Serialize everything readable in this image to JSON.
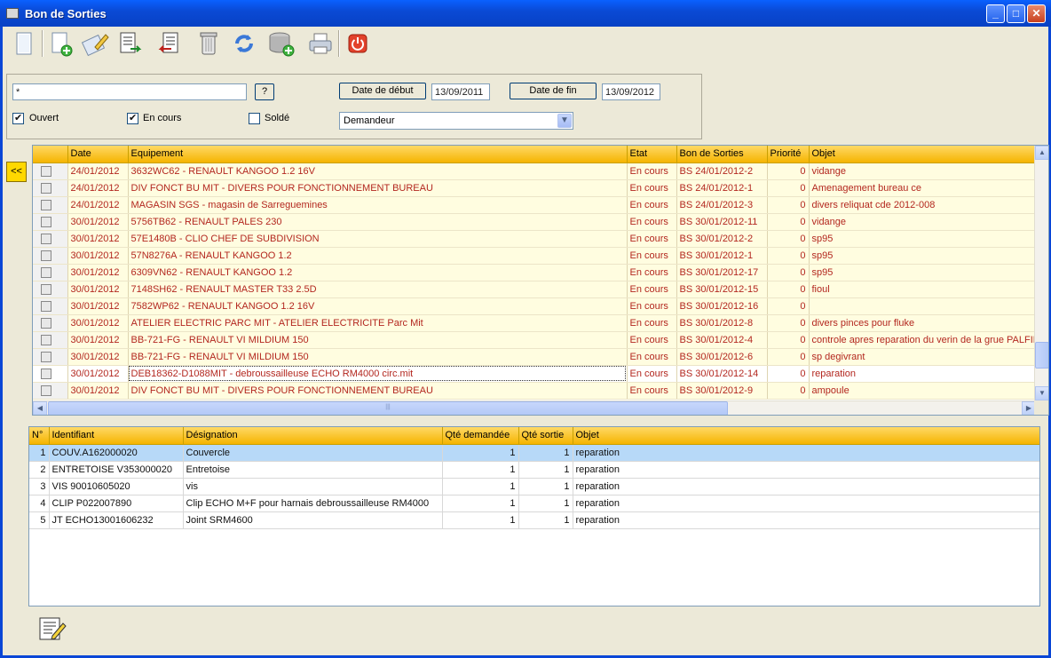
{
  "window": {
    "title": "Bon de Sorties"
  },
  "toolbar": {
    "icons": [
      "new-document-icon",
      "add-document-icon",
      "edit-icon",
      "export-icon",
      "import-icon",
      "delete-icon",
      "refresh-icon",
      "database-add-icon",
      "print-icon",
      "power-icon"
    ]
  },
  "filters": {
    "search_value": "*",
    "help_label": "?",
    "date_debut_label": "Date de début",
    "date_debut_value": "13/09/2011",
    "date_fin_label": "Date de fin",
    "date_fin_value": "13/09/2012",
    "ouvert_label": "Ouvert",
    "ouvert_checked": true,
    "encours_label": "En cours",
    "encours_checked": true,
    "solde_label": "Soldé",
    "solde_checked": false,
    "group_select": "Demandeur"
  },
  "collapse_label": "<<",
  "sorties": {
    "columns": [
      "Date",
      "Equipement",
      "Etat",
      "Bon de Sorties",
      "Priorité",
      "Objet"
    ],
    "rows": [
      [
        "24/01/2012",
        "3632WC62 - RENAULT KANGOO 1.2 16V",
        "En cours",
        "BS 24/01/2012-2",
        "0",
        "vidange"
      ],
      [
        "24/01/2012",
        "DIV FONCT BU MIT - DIVERS POUR FONCTIONNEMENT BUREAU",
        "En cours",
        "BS 24/01/2012-1",
        "0",
        "Amenagement bureau ce"
      ],
      [
        "24/01/2012",
        "MAGASIN SGS - magasin de Sarreguemines",
        "En cours",
        "BS 24/01/2012-3",
        "0",
        "divers reliquat cde  2012-008"
      ],
      [
        "30/01/2012",
        "5756TB62 - RENAULT PALES 230",
        "En cours",
        "BS 30/01/2012-11",
        "0",
        "vidange"
      ],
      [
        "30/01/2012",
        "57E1480B - CLIO CHEF DE SUBDIVISION",
        "En cours",
        "BS 30/01/2012-2",
        "0",
        "sp95"
      ],
      [
        "30/01/2012",
        "57N8276A - RENAULT KANGOO 1.2",
        "En cours",
        "BS 30/01/2012-1",
        "0",
        "sp95"
      ],
      [
        "30/01/2012",
        "6309VN62 - RENAULT KANGOO 1.2",
        "En cours",
        "BS 30/01/2012-17",
        "0",
        "sp95"
      ],
      [
        "30/01/2012",
        "7148SH62 - RENAULT MASTER T33 2.5D",
        "En cours",
        "BS 30/01/2012-15",
        "0",
        "fioul"
      ],
      [
        "30/01/2012",
        "7582WP62 - RENAULT KANGOO 1.2 16V",
        "En cours",
        "BS 30/01/2012-16",
        "0",
        ""
      ],
      [
        "30/01/2012",
        "ATELIER ELECTRIC PARC MIT - ATELIER ELECTRICITE Parc Mit",
        "En cours",
        "BS 30/01/2012-8",
        "0",
        "divers pinces pour fluke"
      ],
      [
        "30/01/2012",
        "BB-721-FG - RENAULT VI MILDIUM 150",
        "En cours",
        "BS 30/01/2012-4",
        "0",
        "controle apres reparation du verin de la grue PALFINGER"
      ],
      [
        "30/01/2012",
        "BB-721-FG - RENAULT VI MILDIUM 150",
        "En cours",
        "BS 30/01/2012-6",
        "0",
        "sp degivrant"
      ],
      [
        "30/01/2012",
        "DEB18362-D1088MIT  - debroussailleuse ECHO RM4000 circ.mit",
        "En cours",
        "BS 30/01/2012-14",
        "0",
        "reparation"
      ],
      [
        "30/01/2012",
        "DIV FONCT BU MIT - DIVERS POUR FONCTIONNEMENT BUREAU",
        "En cours",
        "BS 30/01/2012-9",
        "0",
        "ampoule"
      ]
    ],
    "selected_index": 12
  },
  "lignes": {
    "columns": [
      "N°",
      "Identifiant",
      "Désignation",
      "Qté demandée",
      "Qté sortie",
      "Objet"
    ],
    "rows": [
      [
        "1",
        "COUV.A162000020",
        "Couvercle",
        "1",
        "1",
        "reparation"
      ],
      [
        "2",
        "ENTRETOISE V353000020",
        "Entretoise",
        "1",
        "1",
        "reparation"
      ],
      [
        "3",
        "VIS 90010605020",
        "vis",
        "1",
        "1",
        "reparation"
      ],
      [
        "4",
        "CLIP P022007890",
        "Clip ECHO M+F pour harnais debroussailleuse RM4000",
        "1",
        "1",
        "reparation"
      ],
      [
        "5",
        "JT ECHO13001606232",
        "Joint SRM4600",
        "1",
        "1",
        "reparation"
      ]
    ],
    "selected_index": 0
  },
  "colors": {
    "title_bar": "#0a4ad6",
    "header": "#f5b400",
    "row_text": "#b3271f",
    "selection": "#b7d9f8"
  }
}
